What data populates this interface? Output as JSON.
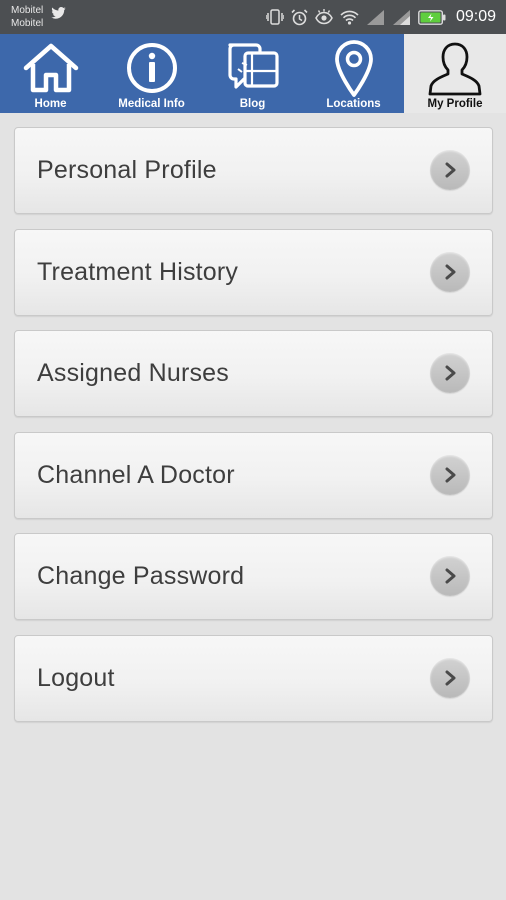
{
  "status_bar": {
    "carrier_1": "Mobitel",
    "carrier_2": "Mobitel",
    "time": "09:09",
    "battery_color": "#5fce3e"
  },
  "tabs": [
    {
      "label": "Home",
      "icon": "home-icon",
      "active": false
    },
    {
      "label": "Medical Info",
      "icon": "info-icon",
      "active": false
    },
    {
      "label": "Blog",
      "icon": "blog-icon",
      "active": false
    },
    {
      "label": "Locations",
      "icon": "location-pin-icon",
      "active": false
    },
    {
      "label": "My Profile",
      "icon": "person-icon",
      "active": true
    }
  ],
  "menu": {
    "items": [
      {
        "label": "Personal Profile"
      },
      {
        "label": "Treatment History"
      },
      {
        "label": "Assigned Nurses"
      },
      {
        "label": "Channel A Doctor"
      },
      {
        "label": "Change Password"
      },
      {
        "label": "Logout"
      }
    ]
  },
  "colors": {
    "tab_bar": "#3d68ab",
    "active_tab": "#e8e8e8",
    "status_bar": "#4c4f52",
    "page_background": "#e3e3e3"
  }
}
